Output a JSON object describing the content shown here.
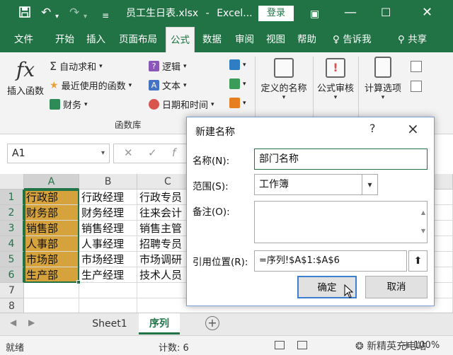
{
  "titlebar": {
    "file_name": "员工生日表.xlsx",
    "app_name": "Excel...",
    "login_label": "登录"
  },
  "ribbon_tabs": [
    "文件",
    "开始",
    "插入",
    "页面布局",
    "公式",
    "数据",
    "审阅",
    "视图",
    "帮助"
  ],
  "active_tab": "公式",
  "tell_me": "告诉我",
  "share": "共享",
  "ribbon": {
    "insert_function": "插入函数",
    "autosum": "自动求和",
    "recent_used": "最近使用的函数",
    "financial": "财务",
    "logical": "逻辑",
    "text": "文本",
    "date_time": "日期和时间",
    "defined_names": "定义的名称",
    "formula_auditing": "公式审核",
    "calc_options": "计算选项",
    "group_label": "函数库"
  },
  "formula_bar": {
    "name_box": "A1"
  },
  "grid": {
    "columns": [
      "A",
      "B",
      "C"
    ],
    "rows": [
      "1",
      "2",
      "3",
      "4",
      "5",
      "6",
      "7",
      "8"
    ],
    "cells": [
      [
        "行政部",
        "行政经理",
        "行政专员"
      ],
      [
        "财务部",
        "财务经理",
        "往来会计"
      ],
      [
        "销售部",
        "销售经理",
        "销售主管"
      ],
      [
        "人事部",
        "人事经理",
        "招聘专员"
      ],
      [
        "市场部",
        "市场经理",
        "市场调研"
      ],
      [
        "生产部",
        "生产经理",
        "技术人员"
      ],
      [
        "",
        "",
        ""
      ],
      [
        "",
        "",
        ""
      ]
    ]
  },
  "sheets": [
    "Sheet1",
    "序列"
  ],
  "active_sheet": "序列",
  "status": {
    "mode": "就绪",
    "count": "计数: 6",
    "zoom": "100%",
    "watermark": "新精英充电站"
  },
  "dialog": {
    "title": "新建名称",
    "help": "?",
    "close": "×",
    "name_label": "名称(N):",
    "name_value": "部门名称",
    "scope_label": "范围(S):",
    "scope_value": "工作簿",
    "comment_label": "备注(O):",
    "ref_label": "引用位置(R):",
    "ref_value": "=序列!$A$1:$A$6",
    "ok_label": "确定",
    "cancel_label": "取消"
  }
}
